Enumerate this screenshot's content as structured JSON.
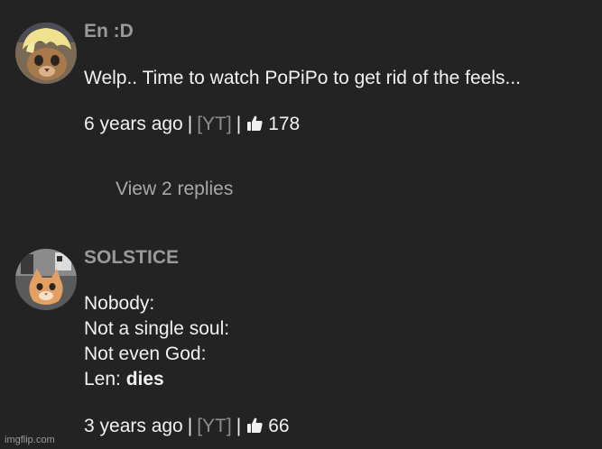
{
  "comments": [
    {
      "author": "En :D",
      "lines": [
        "Welp.. Time to watch PoPiPo to get rid of the feels..."
      ],
      "time": "6 years ago",
      "pipe1": "|",
      "source": "[YT]",
      "pipe2": "|",
      "likes": "178",
      "replies_label": "View 2 replies"
    },
    {
      "author": "SOLSTICE",
      "lines": [
        "Nobody:",
        "Not a single soul:",
        "Not even God:"
      ],
      "last_line_prefix": "Len: ",
      "last_line_bold": "dies",
      "time": "3 years ago",
      "pipe1": "|",
      "source": "[YT]",
      "pipe2": "|",
      "likes": "66"
    }
  ],
  "watermark": "imgflip.com",
  "colors": {
    "background": "#232323",
    "text": "#f1f1f1",
    "author": "#9a9a9a",
    "muted": "#8d8d8d"
  }
}
